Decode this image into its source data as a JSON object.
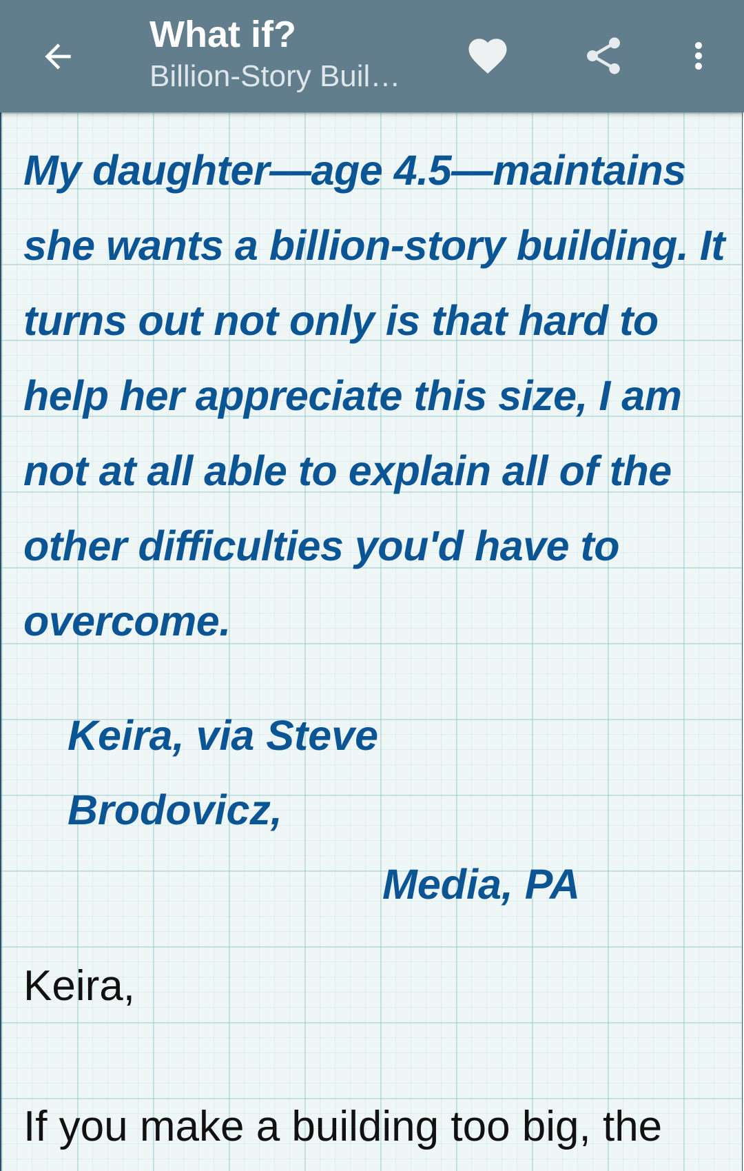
{
  "app_bar": {
    "title": "What if?",
    "subtitle": "Billion-Story Buil…",
    "background_color": "#627d8c",
    "icons": {
      "back": "back-arrow-icon",
      "favorite": "heart-icon",
      "share": "share-icon",
      "more": "more-vert-icon"
    }
  },
  "article": {
    "question": "My daughter—age 4.5—maintains she wants a billion-story building. It turns out not only is that hard to help her appreciate this size, I am not at all able to explain all of the other difficulties you'd have to overcome.",
    "attribution_line1": "Keira, via Steve Brodovicz,",
    "attribution_line2": "Media, PA",
    "salutation": "Keira,",
    "paragraph_start": "If you make a building too big, the",
    "question_color": "#0c5594"
  }
}
